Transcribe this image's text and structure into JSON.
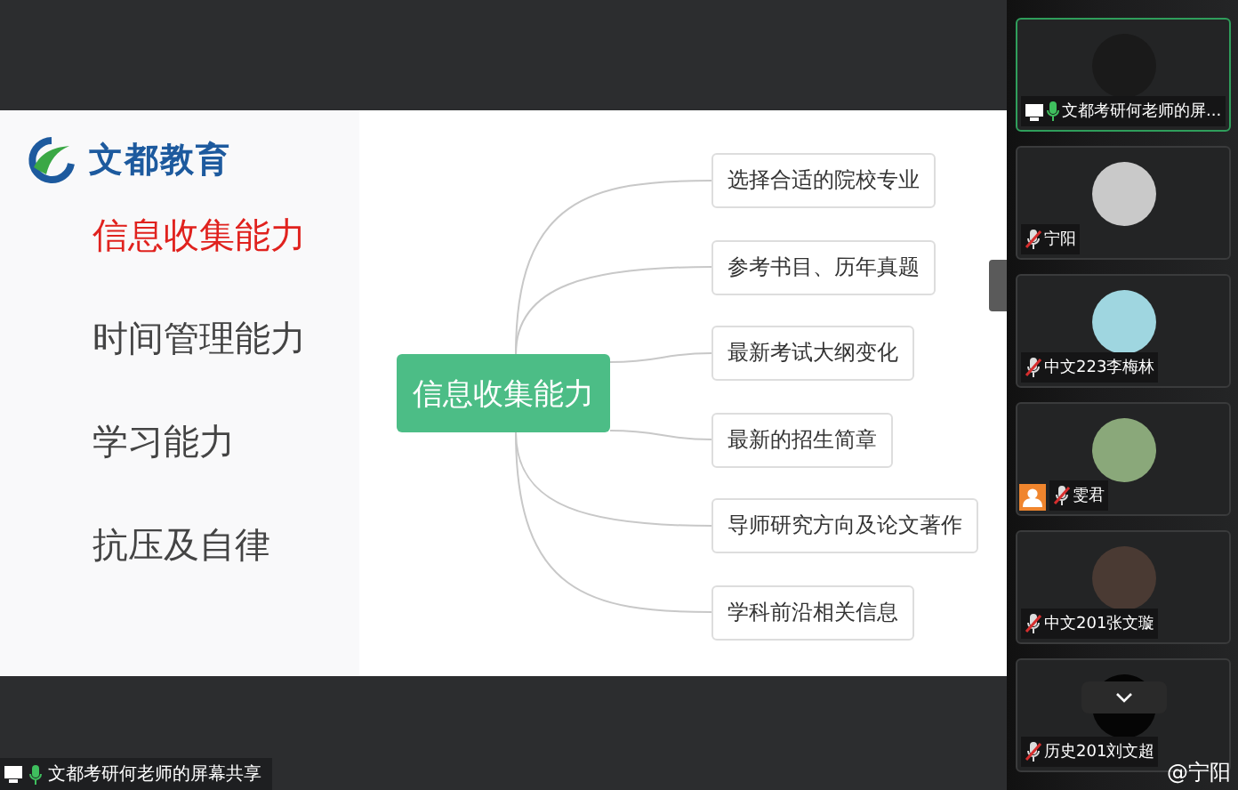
{
  "slide": {
    "logo_text": "文都教育",
    "topics": [
      {
        "label": "信息收集能力",
        "selected": true
      },
      {
        "label": "时间管理能力",
        "selected": false
      },
      {
        "label": "学习能力",
        "selected": false
      },
      {
        "label": "抗压及自律",
        "selected": false
      }
    ],
    "mind_map": {
      "center": "信息收集能力",
      "branches": [
        "选择合适的院校专业",
        "参考书目、历年真题",
        "最新考试大纲变化",
        "最新的招生简章",
        "导师研究方向及论文著作",
        "学科前沿相关信息"
      ]
    }
  },
  "screen_share_label": "文都考研何老师的屏幕共享",
  "participants": [
    {
      "name": "文都考研何老师的屏...",
      "muted": false,
      "screen_sharing": true,
      "host": false,
      "speaking": true,
      "collapse_button": false
    },
    {
      "name": "宁阳",
      "muted": true,
      "screen_sharing": false,
      "host": false,
      "speaking": false,
      "collapse_button": false
    },
    {
      "name": "中文223李梅林",
      "muted": true,
      "screen_sharing": false,
      "host": false,
      "speaking": false,
      "collapse_button": false
    },
    {
      "name": "雯君",
      "muted": true,
      "screen_sharing": false,
      "host": true,
      "speaking": false,
      "collapse_button": false
    },
    {
      "name": "中文201张文璇",
      "muted": true,
      "screen_sharing": false,
      "host": false,
      "speaking": false,
      "collapse_button": false
    },
    {
      "name": "历史201刘文超",
      "muted": true,
      "screen_sharing": false,
      "host": false,
      "speaking": false,
      "collapse_button": true
    }
  ],
  "watermark_user": "@宁阳"
}
